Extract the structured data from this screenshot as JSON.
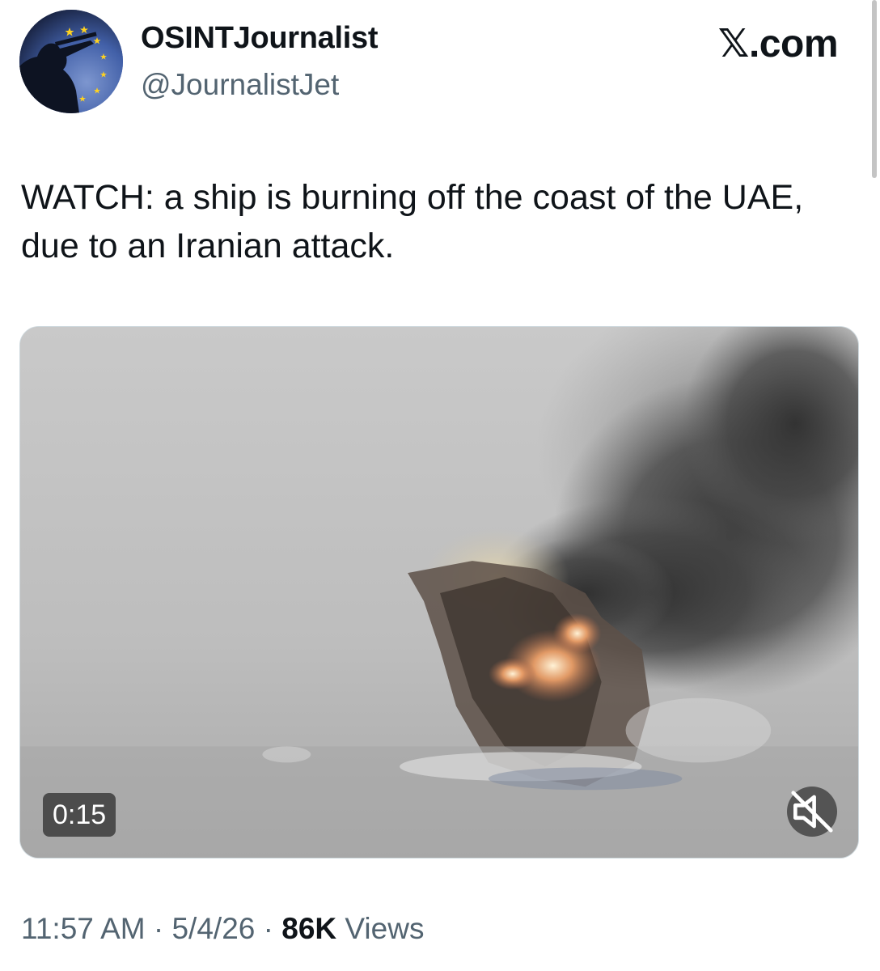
{
  "author": {
    "display_name": "OSINTJournalist",
    "handle": "@JournalistJet",
    "avatar_icon": "soldier-with-rifle-eu-stars-avatar"
  },
  "site": {
    "logo_text": "𝕏.com"
  },
  "post": {
    "text": "WATCH: a ship is burning off the coast of the UAE, due to an Iranian attack."
  },
  "media": {
    "type": "video",
    "duration": "0:15",
    "muted": true,
    "mute_icon": "speaker-muted-icon"
  },
  "meta": {
    "time": "11:57 AM",
    "separator": "·",
    "date": "5/4/26",
    "views_count": "86K",
    "views_label": "Views"
  },
  "colors": {
    "text_primary": "#0f1419",
    "text_secondary": "#536471",
    "border": "#cfd9de"
  }
}
